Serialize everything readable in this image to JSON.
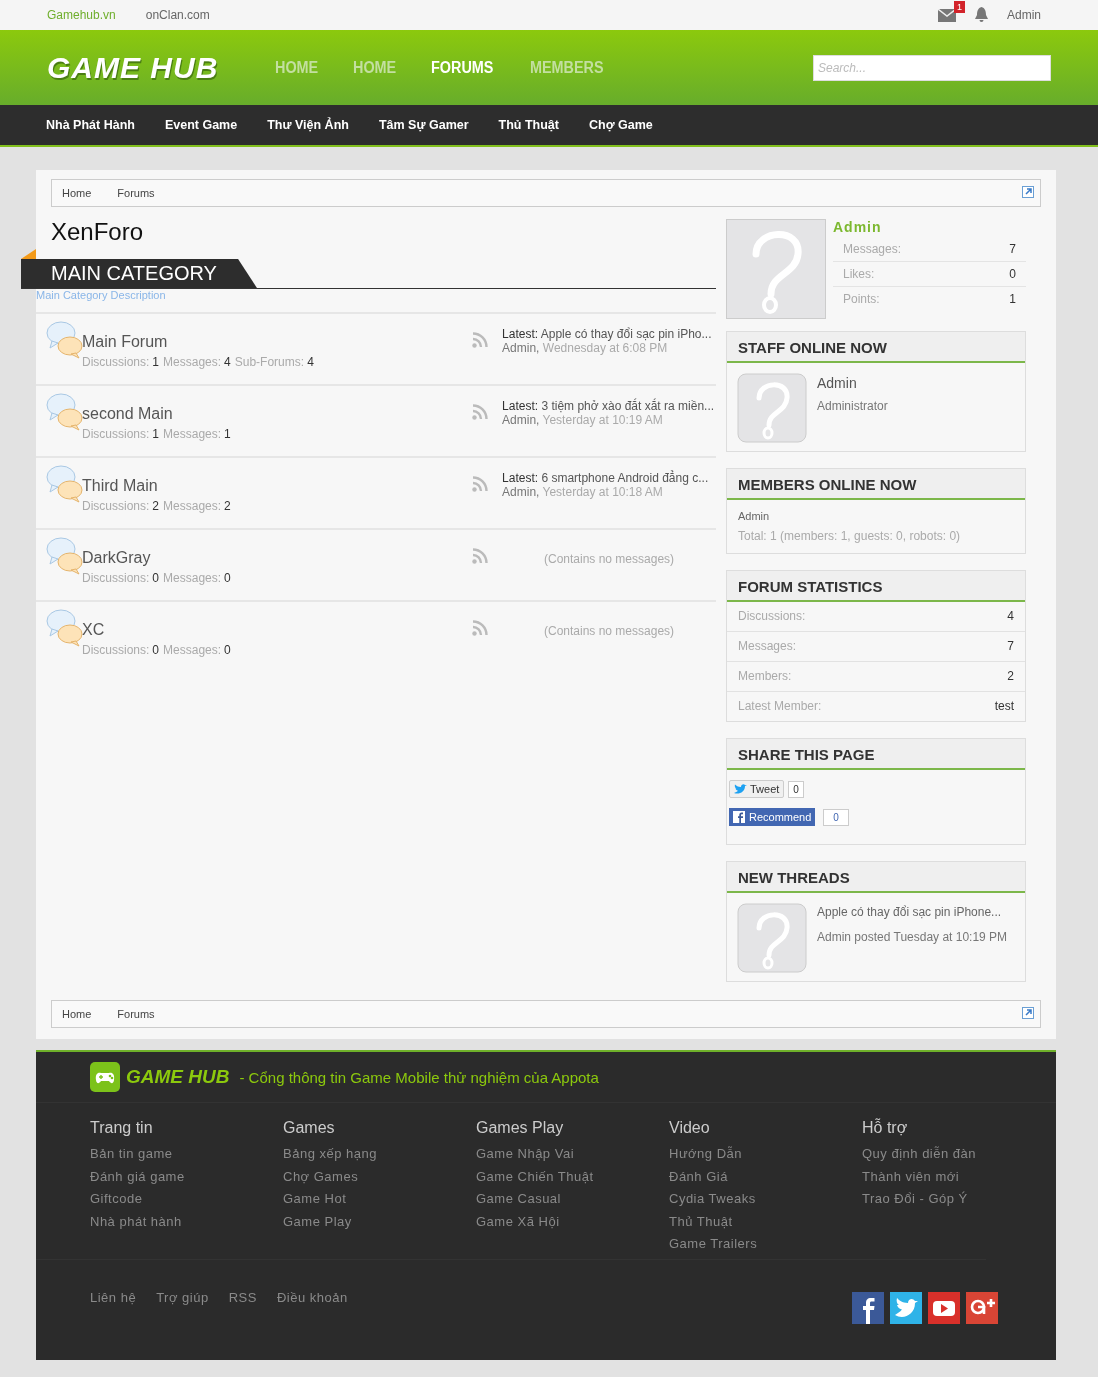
{
  "top_bar": {
    "links": [
      "Gamehub.vn",
      "onClan.com"
    ],
    "mail_badge": "1",
    "user": "Admin"
  },
  "header": {
    "logo": "GAME HUB",
    "tabs": [
      {
        "label": "HOME",
        "selected": false
      },
      {
        "label": "HOME",
        "selected": false
      },
      {
        "label": "FORUMS",
        "selected": true
      },
      {
        "label": "MEMBERS",
        "selected": false
      }
    ],
    "search": {
      "placeholder": "Search..."
    }
  },
  "nav": [
    "Nhà Phát Hành",
    "Event Game",
    "Thư Viện Ảnh",
    "Tâm Sự Gamer",
    "Thủ Thuật",
    "Chợ Game"
  ],
  "breadcrumb": [
    "Home",
    "Forums"
  ],
  "breadcrumb_bottom": [
    "Home",
    "Forums"
  ],
  "title": "XenForo",
  "category": {
    "name": "MAIN CATEGORY",
    "description": "Main Category Description"
  },
  "forums": [
    {
      "name": "Main Forum",
      "stats": [
        {
          "label": "Discussions:",
          "value": "1"
        },
        {
          "label": "Messages:",
          "value": "4"
        },
        {
          "label": "Sub-Forums:",
          "value": "4"
        }
      ],
      "kind": "latest",
      "latest_label": "Latest:",
      "latest_title": "Apple có thay đổi sạc pin iPho...",
      "latest_user": "Admin,",
      "latest_time": "Wednesday at 6:08 PM"
    },
    {
      "name": "second Main",
      "stats": [
        {
          "label": "Discussions:",
          "value": "1"
        },
        {
          "label": "Messages:",
          "value": "1"
        }
      ],
      "kind": "latest",
      "latest_label": "Latest:",
      "latest_title": "3 tiệm phở xào đắt xắt ra miền...",
      "latest_user": "Admin,",
      "latest_time": "Yesterday at 10:19 AM"
    },
    {
      "name": "Third Main",
      "stats": [
        {
          "label": "Discussions:",
          "value": "2"
        },
        {
          "label": "Messages:",
          "value": "2"
        }
      ],
      "kind": "latest",
      "latest_label": "Latest:",
      "latest_title": "6 smartphone Android đẳng c...",
      "latest_user": "Admin,",
      "latest_time": "Yesterday at 10:18 AM"
    },
    {
      "name": "DarkGray",
      "stats": [
        {
          "label": "Discussions:",
          "value": "0"
        },
        {
          "label": "Messages:",
          "value": "0"
        }
      ],
      "kind": "empty",
      "empty_text": "(Contains no messages)"
    },
    {
      "name": "XC",
      "stats": [
        {
          "label": "Discussions:",
          "value": "0"
        },
        {
          "label": "Messages:",
          "value": "0"
        }
      ],
      "kind": "empty",
      "empty_text": "(Contains no messages)"
    }
  ],
  "visitor": {
    "name": "Admin",
    "stats": [
      {
        "label": "Messages:",
        "value": "7"
      },
      {
        "label": "Likes:",
        "value": "0"
      },
      {
        "label": "Points:",
        "value": "1"
      }
    ]
  },
  "staff_online": {
    "title": "STAFF ONLINE NOW",
    "name": "Admin",
    "role": "Administrator"
  },
  "members_online": {
    "title": "MEMBERS ONLINE NOW",
    "names": "Admin",
    "total": "Total: 1 (members: 1, guests: 0, robots: 0)"
  },
  "forum_statistics": {
    "title": "FORUM STATISTICS",
    "rows": [
      {
        "label": "Discussions:",
        "value": "4"
      },
      {
        "label": "Messages:",
        "value": "7"
      },
      {
        "label": "Members:",
        "value": "2"
      },
      {
        "label": "Latest Member:",
        "value": "test"
      }
    ]
  },
  "share": {
    "title": "SHARE THIS PAGE",
    "tweet": "Tweet",
    "tweet_count": "0",
    "recommend": "Recommend",
    "recommend_count": "0"
  },
  "new_threads": {
    "title": "NEW THREADS",
    "thread": "Apple có thay đổi sạc pin iPhone...",
    "meta": "Admin posted Tuesday at 10:19 PM"
  },
  "footer": {
    "logo": "GAME HUB",
    "tagline": "- Cổng thông tin Game Mobile thử nghiệm của Appota",
    "columns": [
      {
        "title": "Trang tin",
        "links": [
          "Bản tin game",
          "Đánh giá game",
          "Giftcode",
          "Nhà phát hành"
        ]
      },
      {
        "title": "Games",
        "links": [
          "Bảng xếp hạng",
          "Chợ Games",
          "Game Hot",
          "Game Play"
        ]
      },
      {
        "title": "Games Play",
        "links": [
          "Game Nhập Vai",
          "Game Chiến Thuật",
          "Game Casual",
          "Game Xã Hội"
        ]
      },
      {
        "title": "Video",
        "links": [
          "Hướng Dẫn",
          "Đánh Giá",
          "Cydia Tweaks",
          "Thủ Thuật",
          "Game Trailers"
        ]
      },
      {
        "title": "Hỗ trợ",
        "links": [
          "Quy định diễn đàn",
          "Thành viên mới",
          "Trao Đổi - Góp Ý"
        ]
      }
    ],
    "bottom_links": [
      "Liên hệ",
      "Trợ giúp",
      "RSS",
      "Điều khoản"
    ]
  }
}
